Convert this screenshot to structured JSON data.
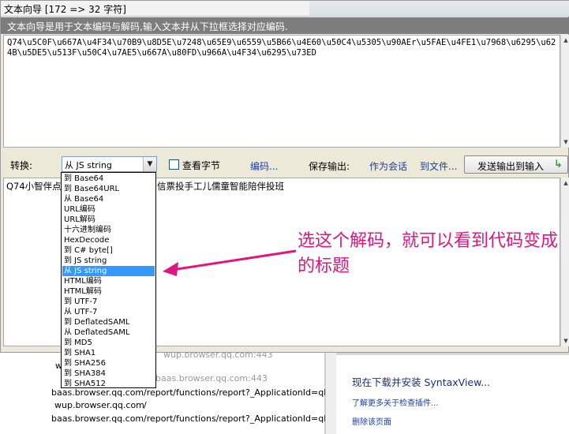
{
  "window": {
    "title": "文本向导 [172 => 32 字符]",
    "info": "文本向导是用于文本编码与解码,输入文本并从下拉框选择对应编码."
  },
  "input": {
    "value": "Q74\\u5C0F\\u667A\\u4F34\\u70B9\\u8D5E\\u7248\\u65E9\\u6559\\u5B66\\u4E60\\u50C4\\u5305\\u90AEr\\u5FAE\\u4FE1\\u7968\\u6295\\u624B\\u5DE5\\u513F\\u50C4\\u7AE5\\u667A\\u80FD\\u966A\\u4F34\\u6295\\u73ED"
  },
  "toolbar": {
    "convert_label": "转换:",
    "combo_value": "从 JS string",
    "view_bytes_label": "查看字节",
    "encoding_link": "编码...",
    "save_label": "保存输出:",
    "as_session_link": "作为会话",
    "to_file_link": "到文件...",
    "send_button": "发送输出到输入"
  },
  "output": {
    "value_left": "Q74小智伴点赞",
    "value_right": "信票投手工儿儒童智能陪伴投班"
  },
  "dropdown": {
    "selected_index": 10,
    "options": [
      "到 Base64",
      "到 Base64URL",
      "从 Base64",
      "URL编码",
      "URL解码",
      "十六进制编码",
      "HexDecode",
      "到 C# byte[]",
      "到 JS string",
      "从 JS string",
      "HTML编码",
      "HTML解码",
      "到 UTF-7",
      "从 UTF-7",
      "到 DeflatedSAML",
      "从 DeflatedSAML",
      "到 MD5",
      "到 SHA1",
      "到 SHA256",
      "到 SHA384",
      "到 SHA512"
    ]
  },
  "annotation": {
    "text": "选这个解码，就可以看到代码变成的标题",
    "color": "#e0157e"
  },
  "background": {
    "rows": [
      {
        "host": "baas.browser.qq.com:443",
        "path": ""
      },
      {
        "host": "baas.browser.qq.com",
        "path": "/report/functions/report?_ApplicationId=qbwel"
      },
      {
        "host": "wup.browser.qq.com",
        "path": "/"
      },
      {
        "host": "baas.browser.qq.com",
        "path": "/report/functions/report?_ApplicationId=qbwel"
      }
    ],
    "faded_top": "wup.browser.qq.com:443",
    "right_title": "现在下载并安装 SyntaxView...",
    "right_link1": "了解更多关于检查插件...",
    "right_link2": "删除该页面"
  }
}
